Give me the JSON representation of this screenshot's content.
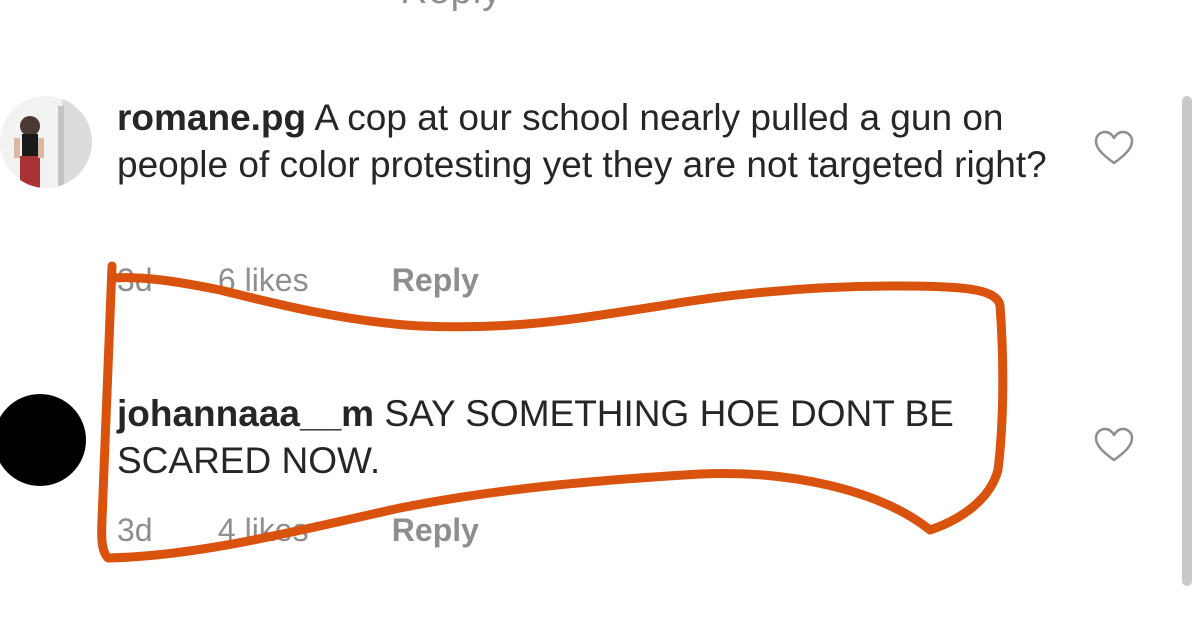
{
  "top_cutoff_text": "Reply",
  "comments": [
    {
      "username": "romane.pg",
      "text": "A cop at our school nearly pulled a gun on people of color protesting yet they are not targeted right?",
      "time": "3d",
      "likes": "6 likes",
      "reply": "Reply",
      "avatar": "profile-photo"
    },
    {
      "username": "johannaaa__m",
      "text": "SAY SOMETHING HOE DONT BE SCARED NOW.",
      "time": "3d",
      "likes": "4 likes",
      "reply": "Reply",
      "avatar": "black-circle"
    }
  ],
  "colors": {
    "text": "#262626",
    "meta": "#8e8e8e",
    "highlight_stroke": "#d9530f",
    "scrollbar": "#c9c9c9"
  },
  "icons": [
    "heart-outline-icon"
  ]
}
